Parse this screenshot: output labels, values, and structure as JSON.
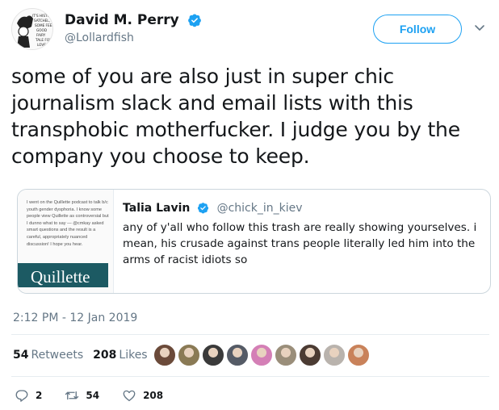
{
  "author": {
    "display_name": "David M. Perry",
    "handle": "@Lollardfish",
    "avatar_text": "IT'S HISTORY SATCHEL, NOT SOME FEEL GOOD FAIRY TALE FOR LOVE"
  },
  "follow_label": "Follow",
  "tweet": {
    "text": "some of you are also just in super chic journalism slack and email lists with this transphobic motherfucker. I judge you by the company you choose to keep.",
    "timestamp": "2:12 PM - 12 Jan 2019"
  },
  "quote": {
    "author": "Talia Lavin",
    "handle": "@chick_in_kiev",
    "text": "any of y'all who follow this trash are really showing yourselves. i mean, his crusade against trans people literally led him into the arms of racist idiots so",
    "media_text": "I went on the Quillette podcast to talk b/c youth gender dysphoria. I know some people view Quillette as controversial but I dunno what to say — @cmkay asked smart questions and the result is a careful, appropriately nuanced discussion! I hope you hear.",
    "media_logo": "Quillette"
  },
  "stats": {
    "retweets_count": "54",
    "retweets_label": "Retweets",
    "likes_count": "208",
    "likes_label": "Likes"
  },
  "liker_colors": [
    "#6b4a3a",
    "#8a7a55",
    "#3a3a3a",
    "#555b66",
    "#d47fb6",
    "#9a8e7a",
    "#4b3b33",
    "#b9b3ad",
    "#c9825a"
  ],
  "actions": {
    "reply_count": "2",
    "retweet_count": "54",
    "like_count": "208"
  },
  "colors": {
    "accent": "#1da1f2",
    "secondary_text": "#657786",
    "border": "#ccd6dd"
  }
}
